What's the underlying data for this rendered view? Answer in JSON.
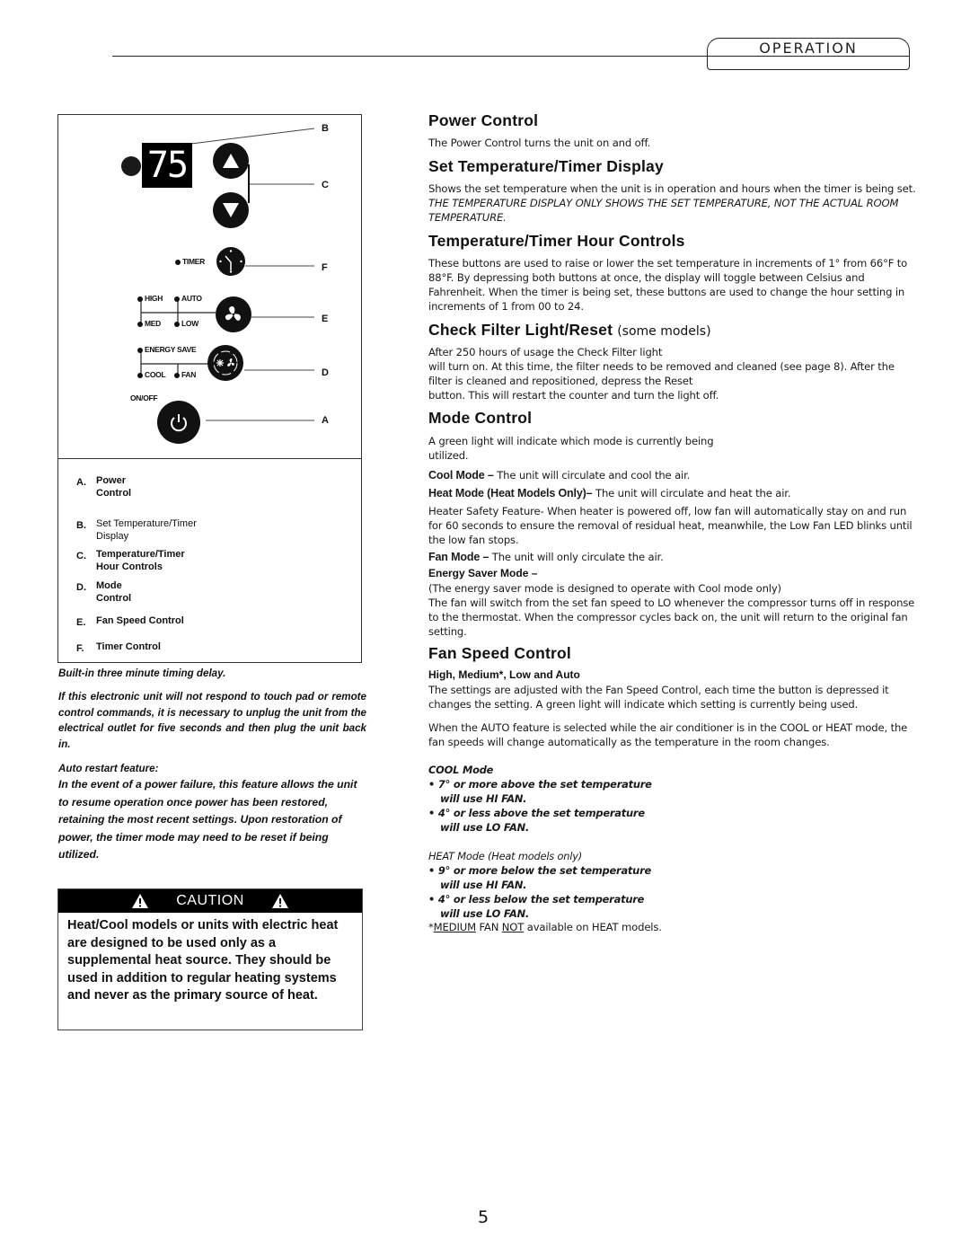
{
  "header": {
    "section_tab": "OPERATION"
  },
  "diagram": {
    "display_value": "75",
    "callouts": [
      "B",
      "C",
      "F",
      "E",
      "D",
      "A"
    ],
    "labels": {
      "timer": "TIMER",
      "high": "HIGH",
      "auto": "AUTO",
      "med": "MED",
      "low": "LOW",
      "energy_save": "ENERGY SAVE",
      "cool": "COOL",
      "fan": "FAN",
      "on_off": "ON/OFF"
    },
    "icons": {
      "up": "triangle-up-icon",
      "down": "triangle-down-icon",
      "timer": "clock-icon",
      "fan": "fan-icon",
      "mode": "snowflake-fan-icon",
      "power": "power-icon"
    },
    "legend": [
      {
        "letter": "A.",
        "text": "Power",
        "text2": "Control"
      },
      {
        "letter": "B.",
        "text": "Set Temperature/Timer",
        "text2": "Display"
      },
      {
        "letter": "C.",
        "text": "Temperature/Timer",
        "text2": "Hour Controls"
      },
      {
        "letter": "D.",
        "text": "Mode",
        "text2": "Control"
      },
      {
        "letter": "E.",
        "text": "Fan Speed Control"
      },
      {
        "letter": "F.",
        "text": "Timer Control"
      }
    ]
  },
  "notes": {
    "timing_delay": "Built-in three minute timing delay.",
    "unplug": "If this electronic unit will not respond to touch pad or remote control commands, it is necessary to unplug the unit from the electrical outlet for five seconds and then plug the unit back in.",
    "auto_restart_title": "Auto restart feature:",
    "auto_restart_body": "In the event of a power failure, this feature allows the unit to resume operation once power has been restored, retaining the most recent settings. Upon restoration of power, the timer mode may need to be reset if being utilized."
  },
  "caution": {
    "title": "CAUTION",
    "body": "Heat/Cool models or units with electric heat are designed to be used only as a supplemental heat source. They should be used in addition to regular heating systems and never as the primary source of heat."
  },
  "sections": {
    "power": {
      "title": "Power Control",
      "body": "The Power Control turns the unit on and off."
    },
    "display": {
      "title": "Set Temperature/Timer Display",
      "body": "Shows the set temperature when the unit is in operation and hours when the timer is being set. ",
      "body_italic": "THE TEMPERATURE DISPLAY ONLY SHOWS THE SET TEMPERATURE, NOT THE ACTUAL ROOM TEMPERATURE."
    },
    "hour_controls": {
      "title": "Temperature/Timer Hour Controls",
      "body": "These buttons are used to raise or lower the set temperature in increments of 1° from 66°F to 88°F. By depressing both buttons at once, the display will toggle between Celsius and Fahrenheit. When the timer is being set, these buttons are used to change the hour setting in increments of 1 from 00 to 24."
    },
    "filter": {
      "title": "Check Filter Light/Reset",
      "title_suffix": "(some models)",
      "line1": "After 250 hours of usage the Check Filter light",
      "line2": "will turn on. At this time, the filter needs to be removed and cleaned (see page 8). After the filter is cleaned and repositioned, depress the Reset",
      "line3": "button. This will restart the counter and turn the light off."
    },
    "mode": {
      "title": "Mode Control",
      "intro": "A green light will indicate which mode is currently being utilized.",
      "cool_label": "Cool Mode –",
      "cool_text": " The unit will circulate and cool the air.",
      "heat_label": "Heat Mode (Heat Models Only)–",
      "heat_text": " The unit will circulate and heat the air.",
      "safety": "Heater Safety Feature- When heater is powered off, low fan will automatically stay on and run for 60 seconds to ensure the removal of residual heat, meanwhile, the Low Fan LED blinks until the low fan stops.",
      "fan_label": "Fan Mode –",
      "fan_text": " The unit will only circulate the air.",
      "energy_label": "Energy Saver Mode –",
      "energy_note": "(The energy saver mode is designed to operate with Cool mode only)",
      "energy_body": "The fan will switch from the set fan speed to LO whenever the compressor turns off in response to the thermostat. When the compressor cycles back on, the unit will return to the original fan setting."
    },
    "fan_speed": {
      "title": "Fan Speed Control",
      "subtitle": "High, Medium*, Low and Auto",
      "body": "The settings are adjusted with the Fan Speed Control, each time the button is depressed it changes the setting. A green light will indicate which setting is currently being used.",
      "auto": "When the AUTO feature is selected while the air conditioner is in the COOL or HEAT mode, the fan speeds will change automatically as the temperature in the room changes.",
      "cool_title": "COOL Mode",
      "cool_b1a": "• 7° or more above the set temperature",
      "cool_b1b": "will use HI FAN.",
      "cool_b2a": "• 4° or less above the set temperature",
      "cool_b2b": "will use LO FAN.",
      "heat_title": "HEAT Mode (Heat models only)",
      "heat_b1a": "• 9° or more below the set temperature",
      "heat_b1b": "will use HI FAN.",
      "heat_b2a": "• 4° or less below the set temperature",
      "heat_b2b": "will use LO FAN.",
      "footnote_star": "*",
      "footnote_u1": "MEDIUM",
      "footnote_mid": " FAN ",
      "footnote_u2": "NOT",
      "footnote_end": " available on HEAT models."
    }
  },
  "page_number": "5"
}
